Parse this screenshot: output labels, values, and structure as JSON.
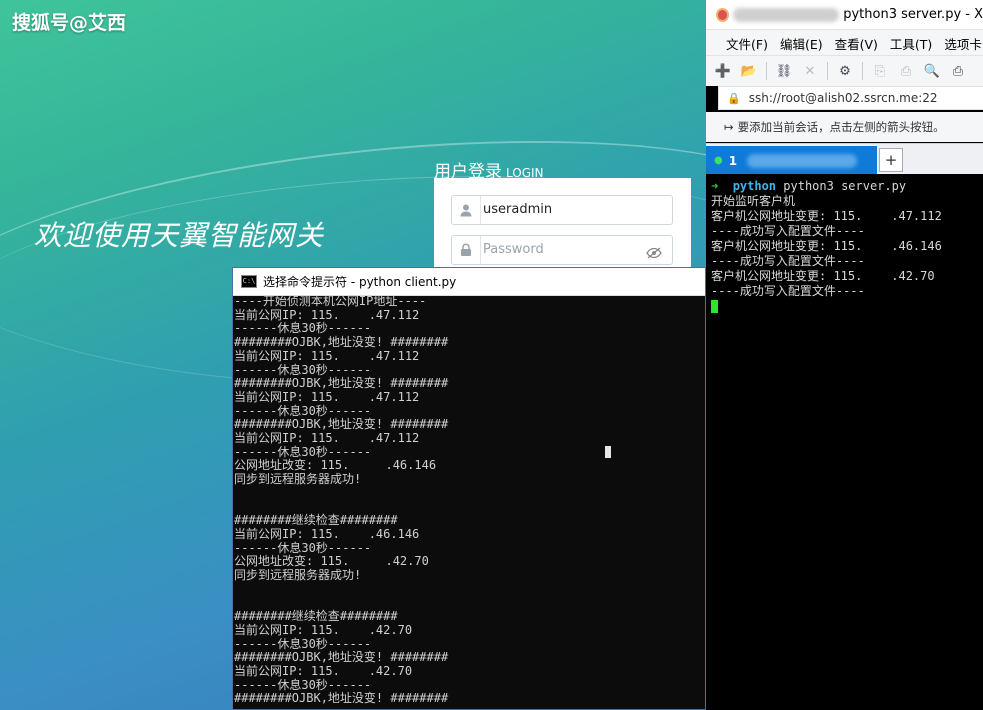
{
  "watermark": "搜狐号@艾西",
  "login_page": {
    "welcome": "欢迎使用天翼智能网关",
    "title": "用户登录",
    "title_en": "LOGIN",
    "username_value": "useradmin",
    "password_placeholder": "Password"
  },
  "cmd_window": {
    "title": "选择命令提示符 - python  client.py",
    "lines": [
      "----开始侦测本机公网IP地址----",
      "当前公网IP: 115.    .47.112",
      "------休息30秒------",
      "########OJBK,地址没变! ########",
      "当前公网IP: 115.    .47.112",
      "------休息30秒------",
      "########OJBK,地址没变! ########",
      "当前公网IP: 115.    .47.112",
      "------休息30秒------",
      "########OJBK,地址没变! ########",
      "当前公网IP: 115.    .47.112",
      "------休息30秒------",
      "公网地址改变: 115.     .46.146",
      "同步到远程服务器成功!",
      "",
      "",
      "########继续检查########",
      "当前公网IP: 115.    .46.146",
      "------休息30秒------",
      "公网地址改变: 115.     .42.70",
      "同步到远程服务器成功!",
      "",
      "",
      "########继续检查########",
      "当前公网IP: 115.    .42.70",
      "------休息30秒------",
      "########OJBK,地址没变! ########",
      "当前公网IP: 115.    .42.70",
      "------休息30秒------",
      "########OJBK,地址没变! ########"
    ]
  },
  "xshell": {
    "title": "python3 server.py - X",
    "menu": [
      "文件(F)",
      "编辑(E)",
      "查看(V)",
      "工具(T)",
      "选项卡("
    ],
    "address": "ssh://root@alish02.ssrcn.me:22",
    "hint": "要添加当前会话，点击左侧的箭头按钮。",
    "tab_label": "1",
    "tab_add": "+",
    "prompt_arrow": "➜",
    "prompt_cmd": "python",
    "command": " python3 server.py",
    "output": [
      "开始监听客户机",
      "客户机公网地址变更: 115.    .47.112",
      "----成功写入配置文件----",
      "客户机公网地址变更: 115.    .46.146",
      "----成功写入配置文件----",
      "客户机公网地址变更: 115.    .42.70",
      "----成功写入配置文件----"
    ]
  }
}
